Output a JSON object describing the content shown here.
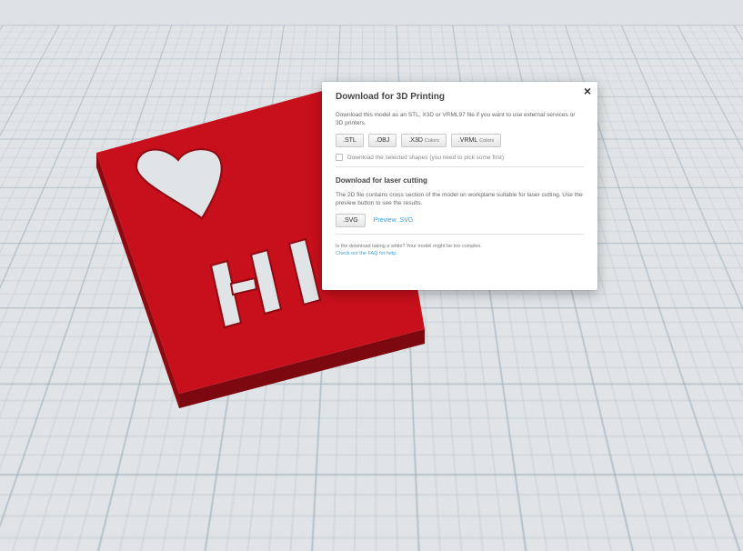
{
  "modal": {
    "close": "×",
    "title_3d": "Download for 3D Printing",
    "desc_3d": "Download this model as an STL, X3D or VRML97 file if you want to use external services or 3D printers.",
    "buttons": [
      {
        "label": ".STL",
        "sub": ""
      },
      {
        "label": ".OBJ",
        "sub": ""
      },
      {
        "label": ".X3D",
        "sub": "Colors"
      },
      {
        "label": ".VRML",
        "sub": "Colors"
      }
    ],
    "checkbox_label": "Download the selected shapes (you need to pick some first)",
    "title_laser": "Download for laser cutting",
    "desc_laser": "The 2D file contains cross section of the model on workplane suitable for laser cutting. Use the preview button to see the results.",
    "svg_button": ".SVG",
    "preview_link": "Preview .SVG",
    "footer_text": "Is the download taking a while? Your model might be too complex.",
    "footer_link": "Check out the FAQ for help."
  },
  "colors": {
    "model_top": "#c8101c",
    "model_side": "#8e0a12",
    "link": "#3c9fd6"
  }
}
